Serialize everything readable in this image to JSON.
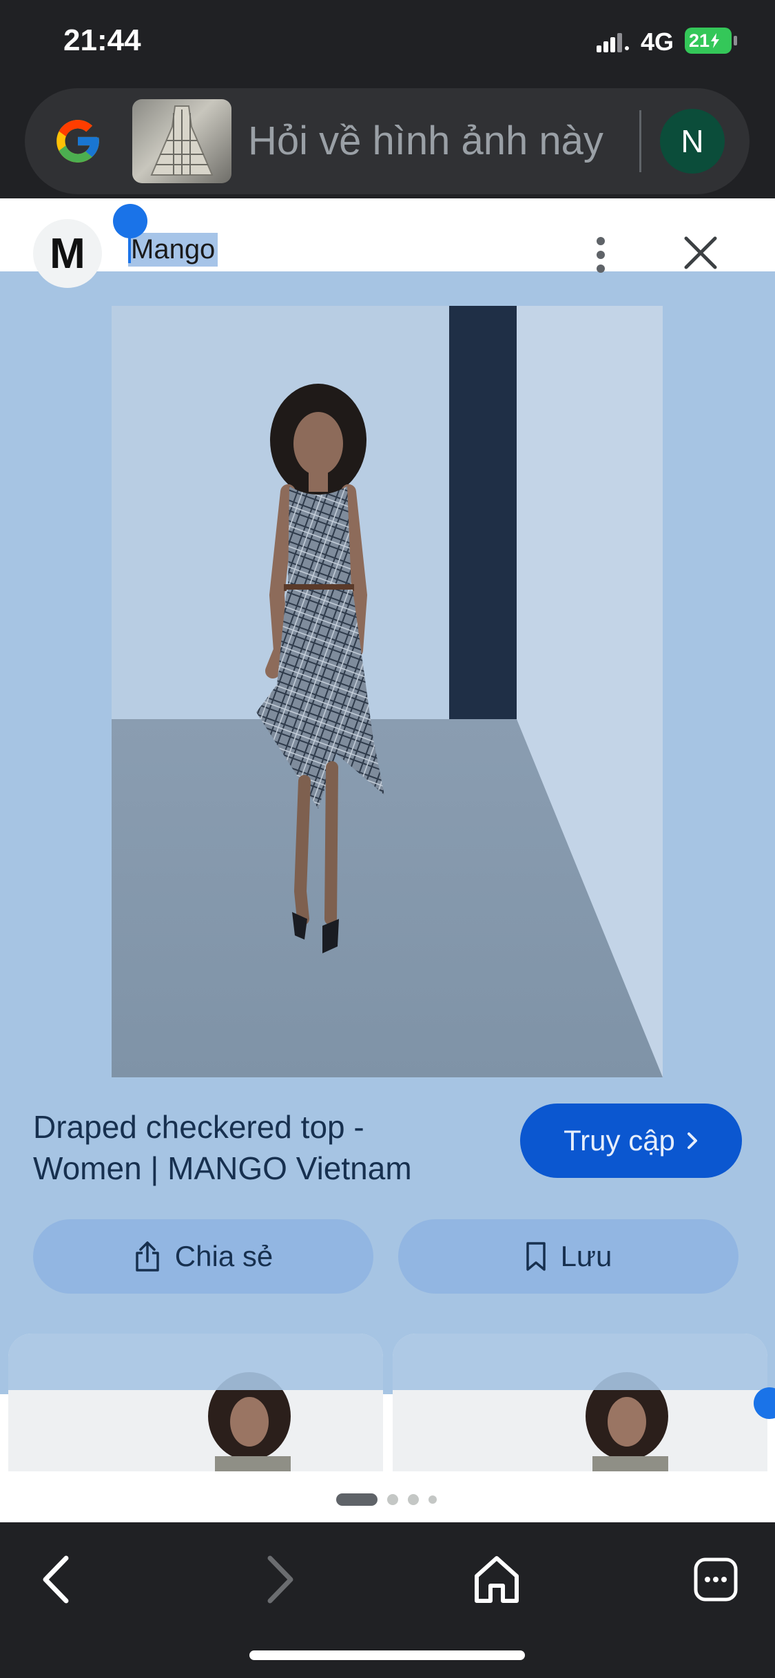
{
  "status_bar": {
    "time": "21:44",
    "network": "4G",
    "battery": "21"
  },
  "search_bar": {
    "query_placeholder": "Hỏi về hình ảnh này",
    "avatar_initial": "N",
    "logo_icon": "google-g-logo"
  },
  "result": {
    "brand_logo_letter": "M",
    "brand_name": "Mango",
    "title": "Draped checkered top - Women | MANGO Vietnam",
    "visit_label": "Truy cập",
    "share_label": "Chia sẻ",
    "save_label": "Lưu",
    "selection_color": "#a6c4e3",
    "accent": "#0b57d0",
    "pagination": {
      "total": 4,
      "active": 1
    }
  },
  "icons": {
    "more": "more-vert-icon",
    "close": "close-icon",
    "share": "share-icon",
    "save": "bookmark-icon",
    "back": "back-arrow-icon",
    "forward": "forward-arrow-icon",
    "home": "home-icon",
    "menu": "menu-dots-icon"
  }
}
